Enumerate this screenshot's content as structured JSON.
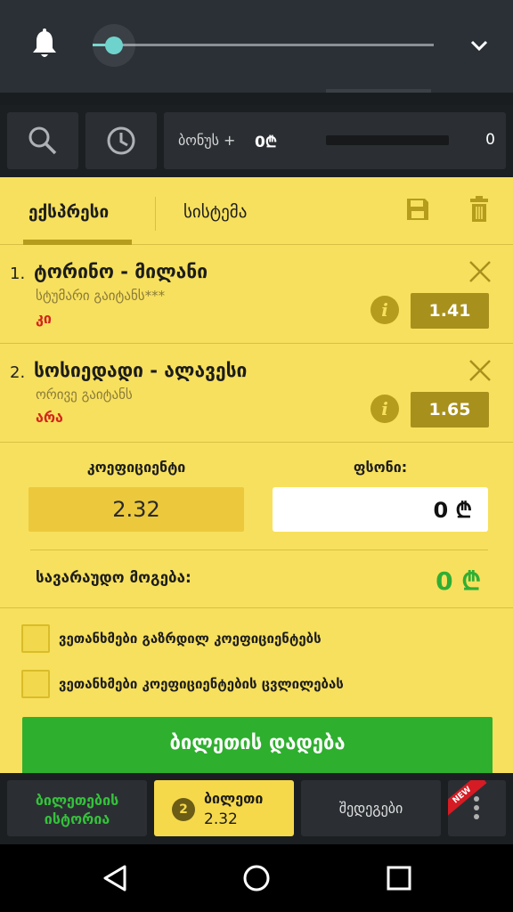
{
  "slider": {
    "level": 0.06
  },
  "bonus": {
    "label": "ბონუს +",
    "value": "0₾",
    "count": "0"
  },
  "tabs": {
    "express": "ექსპრესი",
    "system": "სისტემა"
  },
  "bets": [
    {
      "num": "1.",
      "teams": "ტორინო - მილანი",
      "market": "სტუმარი გაიტანს***",
      "selection": "კი",
      "odd": "1.41"
    },
    {
      "num": "2.",
      "teams": "სოსიედადი - ალავესი",
      "market": "ორივე გაიტანს",
      "selection": "არა",
      "odd": "1.65"
    }
  ],
  "calc": {
    "coef_label": "კოეფიციენტი",
    "coef_value": "2.32",
    "stake_label": "ფსონი:",
    "stake_value": "0 ₾",
    "win_label": "სავარაუდო მოგება:",
    "win_value": "0 ₾"
  },
  "agreements": [
    "ვეთანხმები გაზრდილ კოეფიციენტებს",
    "ვეთანხმები კოეფიციენტების ცვლილებას"
  ],
  "place_button": "ბილეთის დადება",
  "bottom_nav": {
    "history": "ბილეთების ისტორია",
    "ticket_badge": "2",
    "ticket_label": "ბილეთი",
    "ticket_coef": "2.32",
    "results": "შედეგები",
    "new_badge": "NEW"
  },
  "colors": {
    "slip_bg": "#f7e05d",
    "accent_dark": "#a8901c",
    "green": "#2eaf2e",
    "selection_red": "#d2261c",
    "topbar": "#2a3036"
  },
  "icons": [
    "bell-icon",
    "chevron-down-icon",
    "search-icon",
    "clock-icon",
    "save-icon",
    "trash-icon",
    "close-icon",
    "info-icon",
    "more-vert-icon",
    "back-icon",
    "home-icon",
    "recents-icon"
  ]
}
